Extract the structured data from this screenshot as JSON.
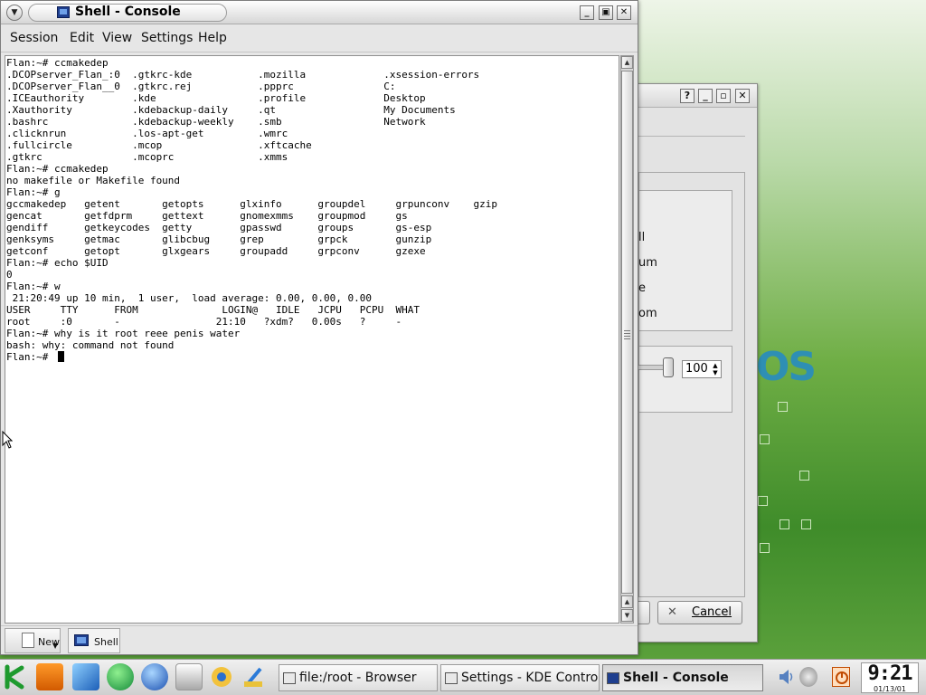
{
  "console_window": {
    "title": "Shell - Console",
    "menu": [
      "Session",
      "Edit",
      "View",
      "Settings",
      "Help"
    ],
    "terminal_lines": [
      "Flan:~# ccmakedep",
      ".DCOPserver_Flan_:0  .gtkrc-kde           .mozilla             .xsession-errors",
      ".DCOPserver_Flan__0  .gtkrc.rej           .ppprc               C:",
      ".ICEauthority        .kde                 .profile             Desktop",
      ".Xauthority          .kdebackup-daily     .qt                  My Documents",
      ".bashrc              .kdebackup-weekly    .smb                 Network",
      ".clicknrun           .los-apt-get         .wmrc",
      ".fullcircle          .mcop                .xftcache",
      ".gtkrc               .mcoprc              .xmms",
      "Flan:~# ccmakedep",
      "no makefile or Makefile found",
      "Flan:~# g",
      "gccmakedep   getent       getopts      glxinfo      groupdel     grpunconv    gzip",
      "gencat       getfdprm     gettext      gnomexmms    groupmod     gs",
      "gendiff      getkeycodes  getty        gpasswd      groups       gs-esp",
      "genksyms     getmac       glibcbug     grep         grpck        gunzip",
      "getconf      getopt       glxgears     groupadd     grpconv      gzexe",
      "Flan:~# echo $UID",
      "0",
      "Flan:~# w",
      " 21:20:49 up 10 min,  1 user,  load average: 0.00, 0.00, 0.00",
      "USER     TTY      FROM              LOGIN@   IDLE   JCPU   PCPU  WHAT",
      "root     :0       -                21:10   ?xdm?   0.00s   ?     -",
      "Flan:~# why is it root reee penis water",
      "bash: why: command not found",
      "Flan:~# "
    ],
    "session_tabs": {
      "new_label": "New",
      "shell_label": "Shell"
    }
  },
  "control_dialog": {
    "partial_labels": [
      "ll",
      "um",
      "e",
      "om"
    ],
    "spin_value": "100",
    "cancel_label": "Cancel"
  },
  "wallpaper": {
    "logo_text": "OS"
  },
  "taskbar": {
    "tasks": [
      {
        "label": "file:/root - Browser",
        "active": false
      },
      {
        "label": "Settings - KDE Control",
        "active": false
      },
      {
        "label": "Shell - Console",
        "active": true
      }
    ],
    "clock_time": "9:21",
    "clock_date": "01/13/01"
  },
  "colors": {
    "accent": "#1f3f8f",
    "desktop_green": "#5aa03b",
    "terminal_bg": "#ffffff"
  }
}
